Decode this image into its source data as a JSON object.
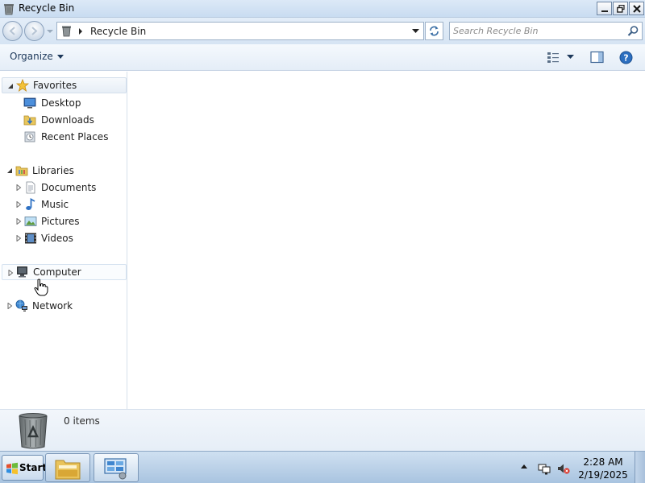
{
  "window": {
    "title": "Recycle Bin",
    "icon": "recycle-bin-icon",
    "buttons": [
      "minimize-icon",
      "restore-icon",
      "close-icon"
    ]
  },
  "address_bar": {
    "path": "Recycle Bin",
    "icon": "recycle-bin-icon"
  },
  "search": {
    "placeholder": "Search Recycle Bin",
    "value": ""
  },
  "toolbar": {
    "organize_label": "Organize",
    "icons": [
      "view-options-icon",
      "preview-pane-icon",
      "help-icon"
    ]
  },
  "navigation": {
    "favorites": {
      "label": "Favorites",
      "icon": "star-icon",
      "expanded": true,
      "items": [
        {
          "label": "Desktop",
          "icon": "desktop-icon"
        },
        {
          "label": "Downloads",
          "icon": "downloads-folder-icon"
        },
        {
          "label": "Recent Places",
          "icon": "recent-places-icon"
        }
      ]
    },
    "libraries": {
      "label": "Libraries",
      "icon": "libraries-folder-icon",
      "expanded": true,
      "items": [
        {
          "label": "Documents",
          "icon": "documents-icon"
        },
        {
          "label": "Music",
          "icon": "music-note-icon"
        },
        {
          "label": "Pictures",
          "icon": "pictures-icon"
        },
        {
          "label": "Videos",
          "icon": "film-strip-icon"
        }
      ]
    },
    "computer": {
      "label": "Computer",
      "icon": "computer-icon"
    },
    "network": {
      "label": "Network",
      "icon": "network-icon"
    }
  },
  "details": {
    "count_text": "0 items",
    "icon": "recycle-bin-icon"
  },
  "taskbar": {
    "start_label": "Start",
    "tasks": [
      "windows-explorer-icon",
      "control-panel-icon"
    ],
    "tray_icons": [
      "show-hidden-icons-arrow",
      "network-tray-icon",
      "volume-muted-icon"
    ],
    "time": "2:28 AM",
    "date": "2/19/2025"
  },
  "colors": {
    "window_chrome": "#d6e4f3",
    "toolbar_text": "#1e395b",
    "taskbar": "#a9c4e0"
  }
}
